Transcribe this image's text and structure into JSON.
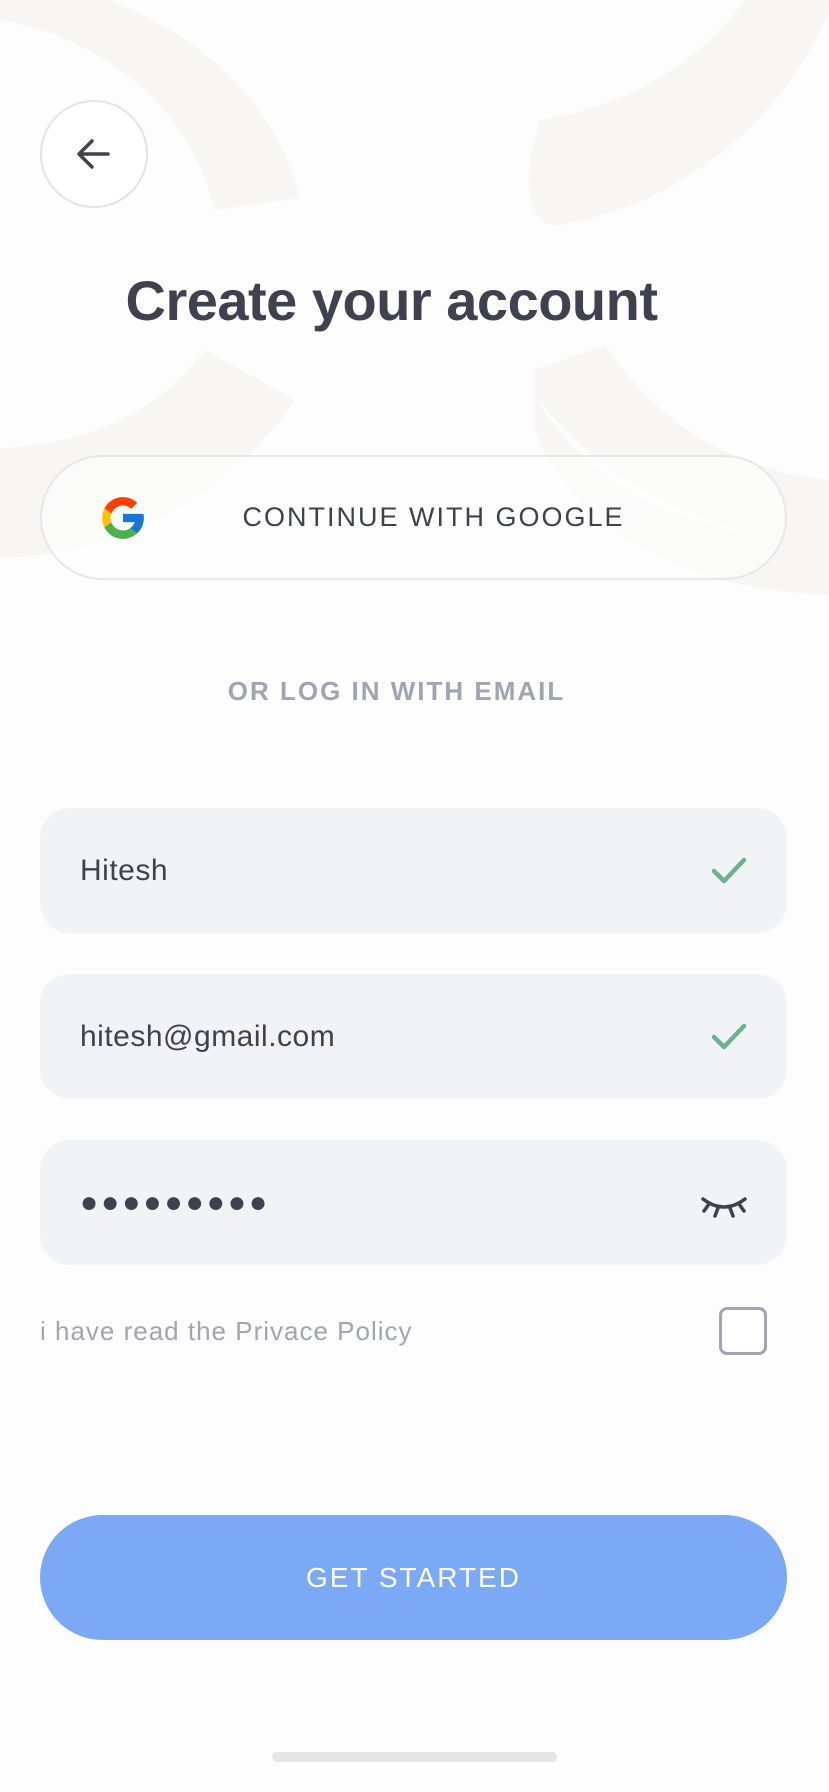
{
  "header": {
    "back_icon": "arrow-left-icon",
    "title": "Create your account"
  },
  "google": {
    "icon": "google-g-icon",
    "label": "CONTINUE WITH GOOGLE"
  },
  "divider": {
    "label": "OR LOG IN WITH EMAIL"
  },
  "form": {
    "name": {
      "value": "Hitesh",
      "status_icon": "check-icon",
      "status_color": "#6cb28e"
    },
    "email": {
      "value": "hitesh@gmail.com",
      "status_icon": "check-icon",
      "status_color": "#6cb28e"
    },
    "password": {
      "masked_value": "●●●●●●●●●",
      "toggle_icon": "eye-closed-icon"
    },
    "policy": {
      "label": "i have read the Privace Policy",
      "checked": false
    }
  },
  "cta": {
    "label": "GET STARTED",
    "color": "#7ba9f6"
  },
  "colors": {
    "text_primary": "#3f414e",
    "text_secondary": "#a1a4b2",
    "field_bg": "#f2f3f7"
  }
}
